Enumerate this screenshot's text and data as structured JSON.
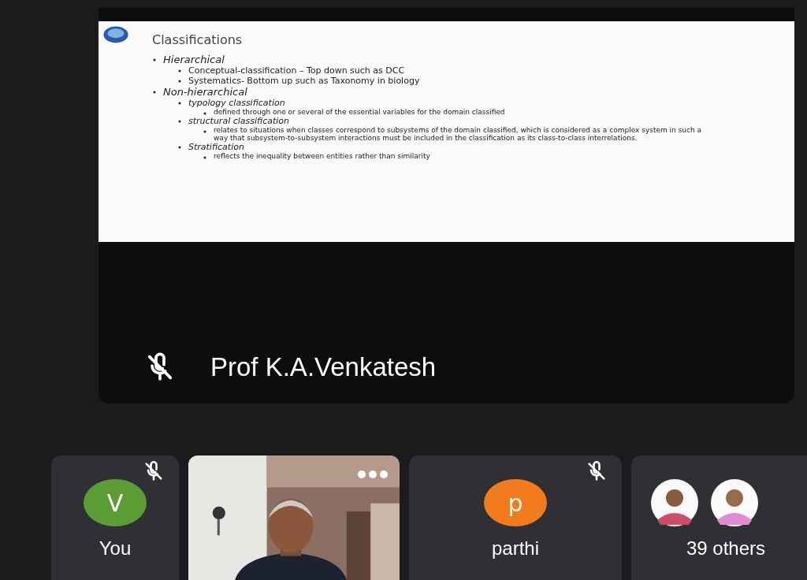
{
  "presenter": {
    "name": "Prof K.A.Venkatesh",
    "muted": true,
    "slide": {
      "title": "Classifications",
      "items": [
        {
          "text": "Hierarchical",
          "italic": true,
          "children": [
            {
              "text": "Conceptual-classification – Top down such as DCC",
              "italic": false
            },
            {
              "text": "Systematics- Bottom up such as Taxonomy in biology",
              "italic": false
            }
          ]
        },
        {
          "text": "Non-hierarchical",
          "italic": true,
          "children": [
            {
              "text": "typology classification",
              "italic": true,
              "children": [
                {
                  "text": "defined through one or several of the essential variables for the domain classified"
                }
              ]
            },
            {
              "text": "structural classification",
              "italic": true,
              "children": [
                {
                  "text": "relates to situations when classes correspond to subsystems of the domain classified, which is considered as a complex system in such a way that subsystem-to-subsystem interactions must be included in the classification as its class-to-class interrelations."
                }
              ]
            },
            {
              "text": "Stratification",
              "italic": true,
              "children": [
                {
                  "text": "reflects the inequality between entities rather than similarity"
                }
              ]
            }
          ]
        }
      ]
    }
  },
  "tiles": [
    {
      "kind": "avatar",
      "initial": "V",
      "color": "#5c9c35",
      "name": "You",
      "muted": true
    },
    {
      "kind": "video",
      "muted": false
    },
    {
      "kind": "avatar",
      "initial": "p",
      "color": "#f27c1d",
      "name": "parthi",
      "muted": true
    },
    {
      "kind": "group",
      "name": "39 others",
      "muted": false
    }
  ]
}
